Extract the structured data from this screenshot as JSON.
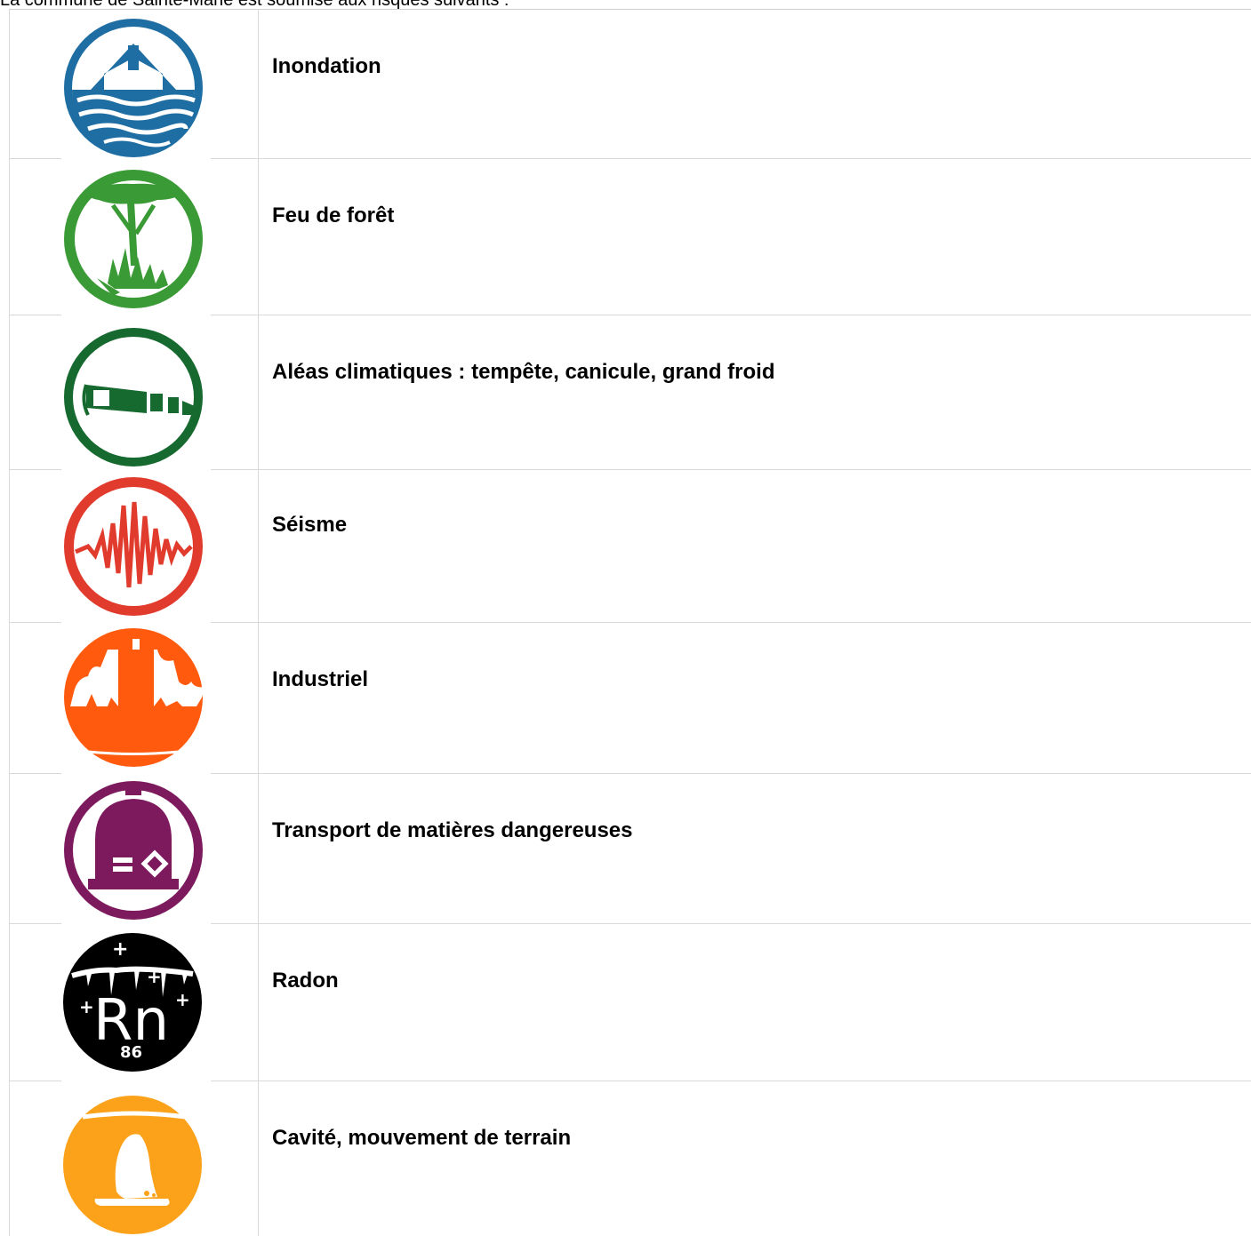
{
  "intro_text": "La commune de Sainte-Marie est soumise aux risques suivants :",
  "risks": [
    {
      "label": "Inondation",
      "icon": "flood-icon",
      "color": "#1f6ea3"
    },
    {
      "label": "Feu de forêt",
      "icon": "forest-fire-icon",
      "color": "#3a9a35"
    },
    {
      "label": "Aléas climatiques : tempête, canicule, grand froid",
      "icon": "climate-icon",
      "color": "#16692f"
    },
    {
      "label": "Séisme",
      "icon": "earthquake-icon",
      "color": "#e03b2c"
    },
    {
      "label": "Industriel",
      "icon": "industrial-icon",
      "color": "#ff5a0d"
    },
    {
      "label": "Transport de matières dangereuses",
      "icon": "hazmat-transport-icon",
      "color": "#7d1a5e"
    },
    {
      "label": "Radon",
      "icon": "radon-icon",
      "color": "#000000",
      "badge_text": "86"
    },
    {
      "label": "Cavité, mouvement de terrain",
      "icon": "cavity-icon",
      "color": "#fca21a"
    }
  ]
}
